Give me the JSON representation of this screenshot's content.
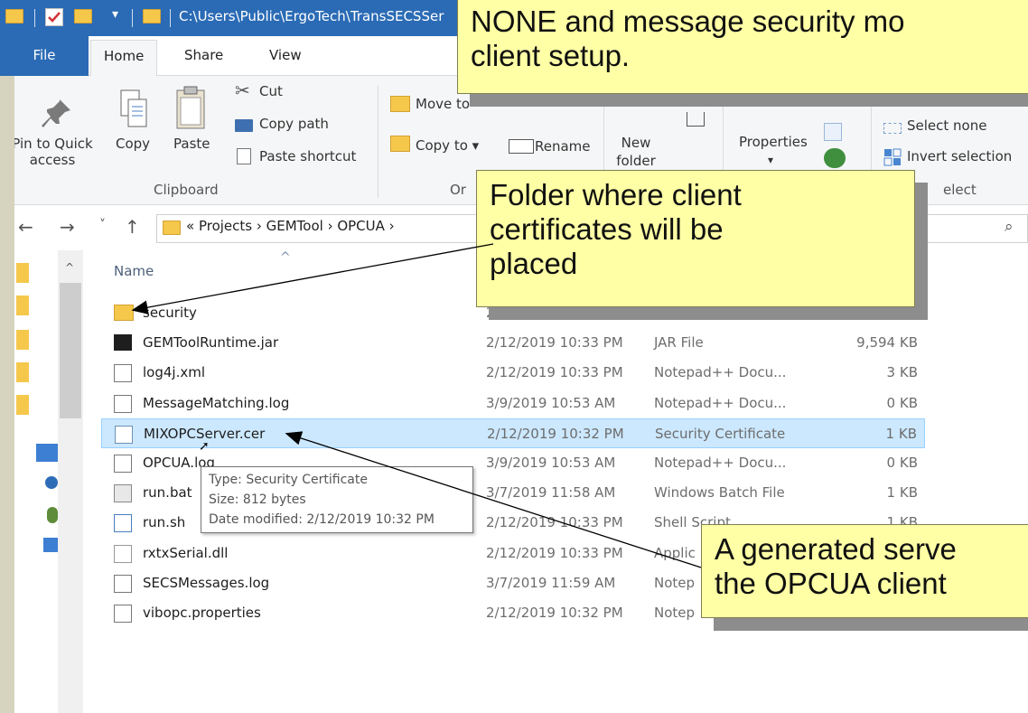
{
  "titlebar": {
    "path": "C:\\Users\\Public\\ErgoTech\\TransSECSSer"
  },
  "tabs": {
    "file": "File",
    "home": "Home",
    "share": "Share",
    "view": "View"
  },
  "ribbon": {
    "pin_label": "Pin to Quick access",
    "pin_line1": "Pin to Quick",
    "pin_line2": "access",
    "copy": "Copy",
    "paste": "Paste",
    "cut": "Cut",
    "copy_path": "Copy path",
    "paste_shortcut": "Paste shortcut",
    "clipboard_group": "Clipboard",
    "move_to": "Move to",
    "copy_to": "Copy to",
    "rename": "Rename",
    "new_folder_line1": "New",
    "new_folder_line2": "folder",
    "properties": "Properties",
    "organize_group_partial": "Or",
    "select_none": "Select none",
    "invert_selection": "Invert selection",
    "select_group_partial": "elect"
  },
  "address": {
    "crumbs": "«  Projects  ›  GEMTool  ›  OPCUA  ›"
  },
  "columns": {
    "name": "Name"
  },
  "files": [
    {
      "name": "security",
      "date": "2/",
      "type": "",
      "size": "",
      "icon": "folder-icon"
    },
    {
      "name": "GEMToolRuntime.jar",
      "date": "2/12/2019 10:33 PM",
      "type": "JAR File",
      "size": "9,594 KB",
      "icon": "7z-icon"
    },
    {
      "name": "log4j.xml",
      "date": "2/12/2019 10:33 PM",
      "type": "Notepad++ Docu...",
      "size": "3 KB",
      "icon": "notepad-icon"
    },
    {
      "name": "MessageMatching.log",
      "date": "3/9/2019 10:53 AM",
      "type": "Notepad++ Docu...",
      "size": "0 KB",
      "icon": "notepad-icon"
    },
    {
      "name": "MIXOPCServer.cer",
      "date": "2/12/2019 10:32 PM",
      "type": "Security Certificate",
      "size": "1 KB",
      "icon": "certificate-icon"
    },
    {
      "name": "OPCUA.log",
      "date": "3/9/2019 10:53 AM",
      "type": "Notepad++ Docu...",
      "size": "0 KB",
      "icon": "notepad-icon"
    },
    {
      "name": "run.bat",
      "date": "3/7/2019 11:58 AM",
      "type": "Windows Batch File",
      "size": "1 KB",
      "icon": "batch-icon"
    },
    {
      "name": "run.sh",
      "date": "2/12/2019 10:33 PM",
      "type": "Shell Script",
      "size": "1 KB",
      "icon": "script-icon"
    },
    {
      "name": "rxtxSerial.dll",
      "date": "2/12/2019 10:33 PM",
      "type": "Applic",
      "size": "",
      "icon": "dll-icon"
    },
    {
      "name": "SECSMessages.log",
      "date": "3/7/2019 11:59 AM",
      "type": "Notep",
      "size": "",
      "icon": "notepad-icon"
    },
    {
      "name": "vibopc.properties",
      "date": "2/12/2019 10:32 PM",
      "type": "Notep",
      "size": "",
      "icon": "notepad-icon"
    }
  ],
  "tooltip": {
    "type_line": "Type: Security Certificate",
    "size_line": "Size: 812 bytes",
    "date_line": "Date modified: 2/12/2019 10:32 PM"
  },
  "callouts": {
    "top_line1": "NONE and message security mo",
    "top_line2": "client setup.",
    "folder_line1": "Folder where client",
    "folder_line2": "certificates will be",
    "folder_line3": "placed",
    "server_line1": "A generated serve",
    "server_line2": "the OPCUA client"
  },
  "colors": {
    "titlebar": "#2b6bb5",
    "callout_bg": "#ffffa6",
    "selection": "#cce8ff"
  }
}
